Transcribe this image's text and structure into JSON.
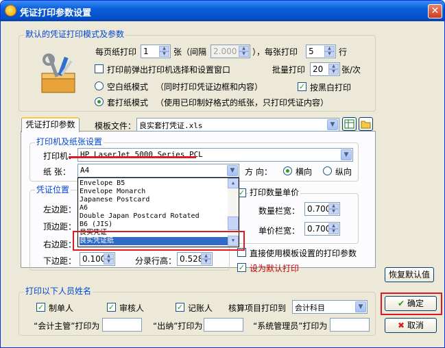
{
  "window": {
    "title": "凭证打印参数设置",
    "close": "✕"
  },
  "defaults_group": {
    "title": "默认的凭证打印模式及参数",
    "per_page_label": "每页纸打印",
    "per_page_value": "1",
    "zhang_gap": "张（间隔",
    "gap_value": "2.000",
    "rparen_per_row": "），每张打印",
    "rows_value": "5",
    "row_unit": "行",
    "popup_label": "打印前弹出打印机选择和设置窗口",
    "batch_label": "批量打印",
    "batch_value": "20",
    "batch_unit": "张/次",
    "blank_mode": "空白纸模式",
    "blank_desc": "（同时打印凭证边框和内容）",
    "bw_label": "按黑白打印",
    "preprint_mode": "套打纸模式",
    "preprint_desc": "（使用已印制好格式的纸张，只打印凭证内容）"
  },
  "tab": {
    "label": "凭证打印参数",
    "template_label": "模板文件：",
    "template_value": "良实套打凭证.xls"
  },
  "printer_group": {
    "title": "打印机及纸张设置",
    "printer_label": "打印机：",
    "printer_value": "HP LaserJet 5000 Series PCL",
    "paper_label": "纸  张：",
    "paper_value": "A4",
    "dir_label": "方  向：",
    "landscape": "横向",
    "portrait": "纵向"
  },
  "paper_options": [
    "Envelope B5",
    "Envelope Monarch",
    "Japanese Postcard",
    "A6",
    "Double Japan Postcard Rotated",
    "B6 (JIS)",
    "良实凭证",
    "良实凭证纸"
  ],
  "position_group": {
    "title": "凭证位置",
    "left_label": "左边距：",
    "top_label": "顶边距：",
    "right_label": "右边距：",
    "bottom_label": "下边距：",
    "bottom_value": "0.100",
    "line_label": "分录行高：",
    "line_value": "0.528"
  },
  "qty_group": {
    "title": "打印数量单价",
    "qty_label": "数量栏宽：",
    "qty_value": "0.700",
    "price_label": "单价栏宽：",
    "price_value": "0.700"
  },
  "options": {
    "use_template": "直接使用模板设置的打印参数",
    "set_default": "设为默认打印"
  },
  "restore_button": "恢复默认值",
  "names_group": {
    "title": "打印以下人员姓名",
    "maker": "制单人",
    "auditor": "审核人",
    "bookkeeper": "记账人",
    "account_label": "核算项目打印到",
    "account_value": "会计科目",
    "chief_label": "“会计主管”打印为",
    "cashier_label": "“出纳”打印为",
    "admin_label": "“系统管理员”打印为"
  },
  "ok_button": "确定",
  "cancel_button": "取消",
  "colors": {
    "accent": "#0046d5",
    "highlight": "#e0181f",
    "selection": "#316ac5"
  }
}
